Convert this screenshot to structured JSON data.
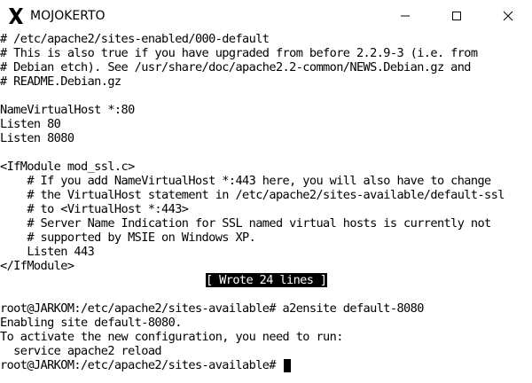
{
  "window": {
    "title": "MOJOKERTO",
    "app_icon": "x-server-icon",
    "controls": {
      "minimize": "minimize-icon",
      "maximize": "maximize-icon",
      "close": "close-icon"
    }
  },
  "terminal": {
    "lines": [
      "# /etc/apache2/sites-enabled/000-default",
      "# This is also true if you have upgraded from before 2.2.9-3 (i.e. from",
      "# Debian etch). See /usr/share/doc/apache2.2-common/NEWS.Debian.gz and",
      "# README.Debian.gz",
      "",
      "NameVirtualHost *:80",
      "Listen 80",
      "Listen 8080",
      "",
      "<IfModule mod_ssl.c>",
      "    # If you add NameVirtualHost *:443 here, you will also have to change",
      "    # the VirtualHost statement in /etc/apache2/sites-available/default-ssl",
      "    # to <VirtualHost *:443>",
      "    # Server Name Indication for SSL named virtual hosts is currently not",
      "    # supported by MSIE on Windows XP.",
      "    Listen 443",
      "</IfModule>"
    ],
    "status_message": "[ Wrote 24 lines ]",
    "output_lines": [
      "",
      "root@JARKOM:/etc/apache2/sites-available# a2ensite default-8080",
      "Enabling site default-8080.",
      "To activate the new configuration, you need to run:",
      "  service apache2 reload"
    ],
    "prompt": "root@JARKOM:/etc/apache2/sites-available# "
  }
}
